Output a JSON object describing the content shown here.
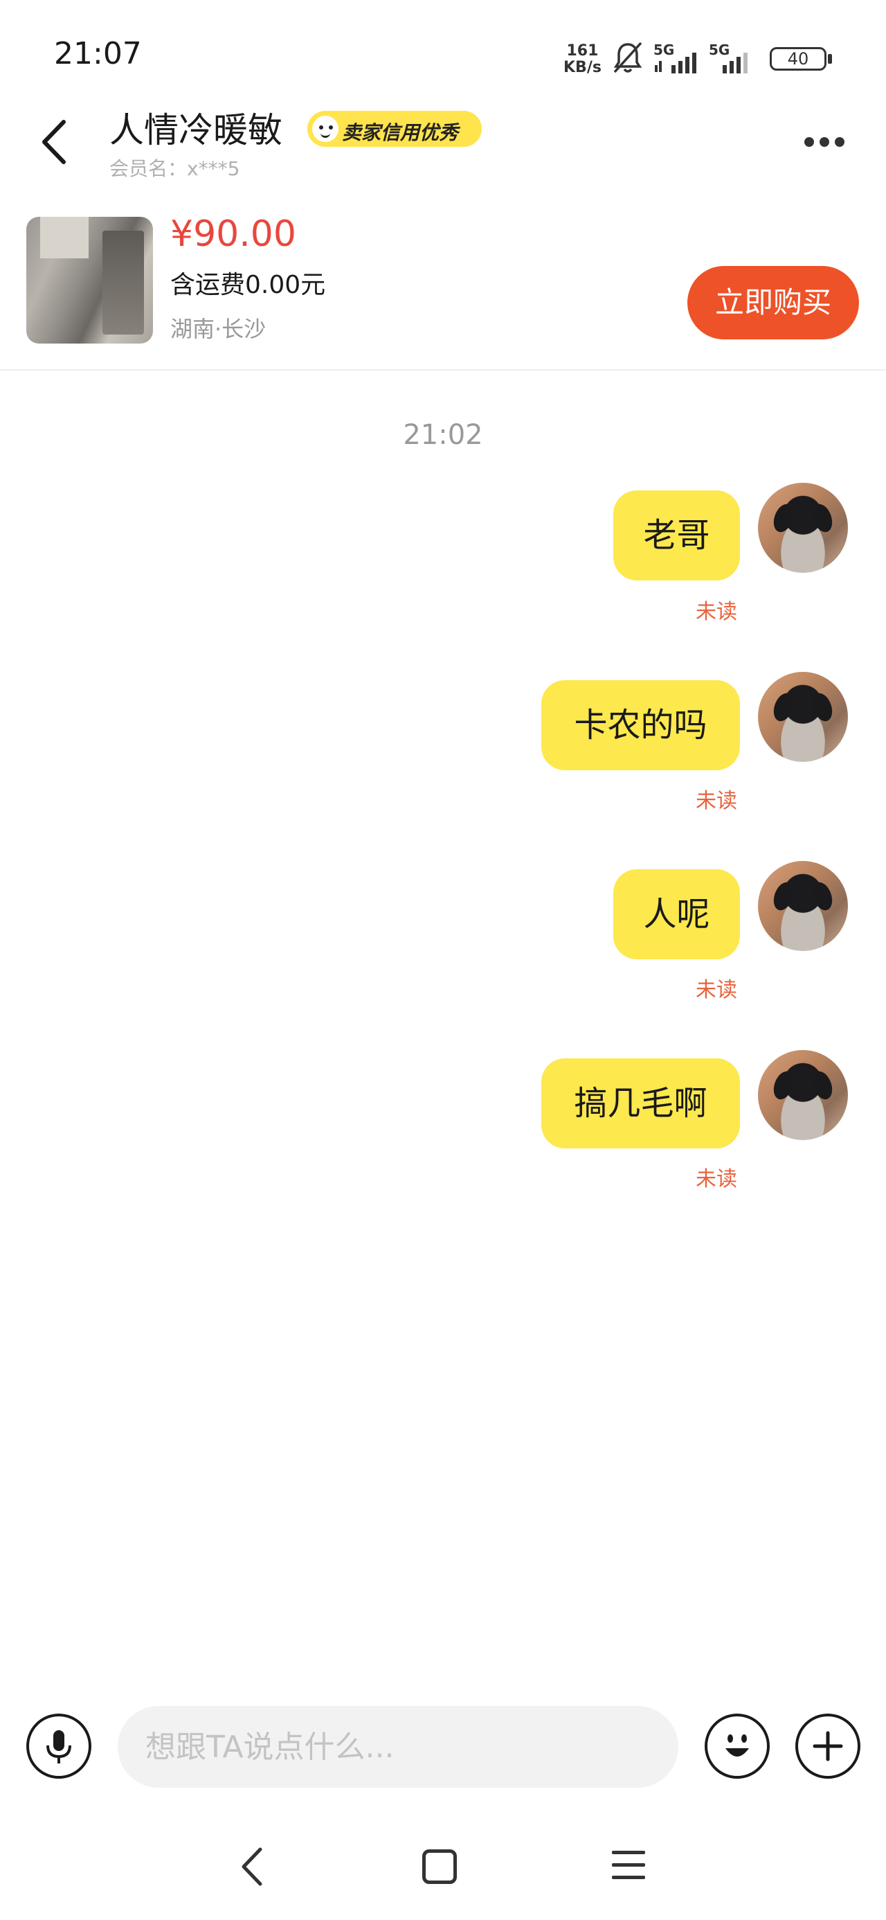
{
  "status_bar": {
    "time": "21:07",
    "net_speed_value": "161",
    "net_speed_unit": "KB/s",
    "signal1_label": "5G",
    "signal2_label": "5G",
    "battery": "40"
  },
  "header": {
    "title": "人情冷暖敏",
    "badge": "卖家信用优秀",
    "member_label": "会员名：",
    "member_value": "x***5"
  },
  "product": {
    "price": "¥90.00",
    "shipping": "含运费0.00元",
    "location": "湖南·长沙",
    "buy_label": "立即购买"
  },
  "chat": {
    "timestamp": "21:02",
    "messages": [
      {
        "text": "老哥",
        "status": "未读"
      },
      {
        "text": "卡农的吗",
        "status": "未读"
      },
      {
        "text": "人呢",
        "status": "未读"
      },
      {
        "text": "搞几毛啊",
        "status": "未读"
      }
    ]
  },
  "input": {
    "placeholder": "想跟TA说点什么..."
  },
  "icons": {
    "back": "back-icon",
    "more": "more-icon",
    "mic": "microphone-icon",
    "emoji": "emoji-icon",
    "plus": "plus-icon"
  },
  "colors": {
    "accent": "#ee5228",
    "price": "#e8473d",
    "bubble": "#fde84d",
    "badge": "#ffe44d",
    "unread": "#e8633d"
  }
}
